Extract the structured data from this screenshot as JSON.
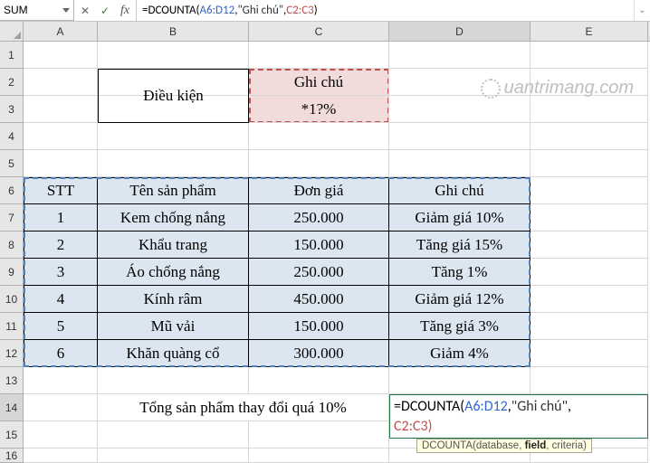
{
  "name_box": "SUM",
  "formula_bar": {
    "prefix": "=",
    "fn": "DCOUNTA",
    "ref1": "A6:D12",
    "str": "\"Ghi chú\"",
    "ref2": "C2:C3"
  },
  "tooltip": {
    "fn": "DCOUNTA",
    "arg1": "database",
    "arg2": "field",
    "arg3": "criteria"
  },
  "col_headers": [
    "A",
    "B",
    "C",
    "D",
    "E"
  ],
  "row_headers": [
    "1",
    "2",
    "3",
    "4",
    "5",
    "6",
    "7",
    "8",
    "9",
    "10",
    "11",
    "12",
    "13",
    "14",
    "15",
    "16"
  ],
  "criteria": {
    "b_label": "Điều kiện",
    "c_header": "Ghi chú",
    "c_pattern": "*1?%"
  },
  "table": {
    "headers": [
      "STT",
      "Tên sản phẩm",
      "Đơn giá",
      "Ghi chú"
    ],
    "rows": [
      [
        "1",
        "Kem chống nắng",
        "250.000",
        "Giảm giá 10%"
      ],
      [
        "2",
        "Khẩu trang",
        "150.000",
        "Tăng giá 15%"
      ],
      [
        "3",
        "Áo chống nắng",
        "250.000",
        "Tăng 1%"
      ],
      [
        "4",
        "Kính râm",
        "450.000",
        "Giảm giá 12%"
      ],
      [
        "5",
        "Mũ vải",
        "150.000",
        "Tăng giá 3%"
      ],
      [
        "6",
        "Khăn quàng cổ",
        "300.000",
        "Giảm 4%"
      ]
    ]
  },
  "summary_label": "Tổng sản phẩm thay đổi quá 10%",
  "watermark": "uantrimang.com",
  "chart_data": {
    "type": "table",
    "title": "Product price-change table (Excel DCOUNTA example)",
    "headers": [
      "STT",
      "Tên sản phẩm",
      "Đơn giá",
      "Ghi chú"
    ],
    "rows": [
      [
        1,
        "Kem chống nắng",
        250000,
        "Giảm giá 10%"
      ],
      [
        2,
        "Khẩu trang",
        150000,
        "Tăng giá 15%"
      ],
      [
        3,
        "Áo chống nắng",
        250000,
        "Tăng 1%"
      ],
      [
        4,
        "Kính râm",
        450000,
        "Giảm giá 12%"
      ],
      [
        5,
        "Mũ vải",
        150000,
        "Tăng giá 3%"
      ],
      [
        6,
        "Khăn quàng cổ",
        300000,
        "Giảm 4%"
      ]
    ],
    "criteria": {
      "field": "Ghi chú",
      "pattern": "*1?%"
    },
    "formula": "=DCOUNTA(A6:D12,\"Ghi chú\",C2:C3)"
  }
}
